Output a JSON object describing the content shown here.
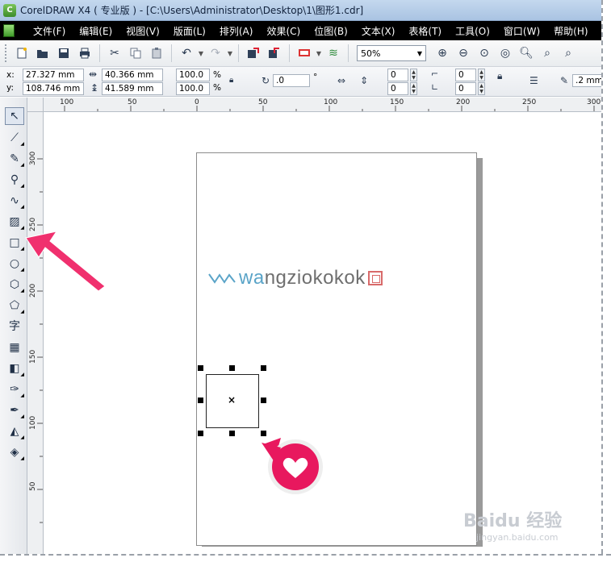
{
  "window": {
    "title": "CorelDRAW X4 ( 专业版 ) - [C:\\Users\\Administrator\\Desktop\\1\\图形1.cdr]",
    "app_icon_label": "C"
  },
  "menu": {
    "items": [
      "文件(F)",
      "编辑(E)",
      "视图(V)",
      "版面(L)",
      "排列(A)",
      "效果(C)",
      "位图(B)",
      "文本(X)",
      "表格(T)",
      "工具(O)",
      "窗口(W)",
      "帮助(H)"
    ]
  },
  "toolbar": {
    "zoom_value": "50%"
  },
  "property_bar": {
    "x_label": "x:",
    "x_value": "27.327 mm",
    "y_label": "y:",
    "y_value": "108.746 mm",
    "width_value": "40.366 mm",
    "height_value": "41.589 mm",
    "scale_x": "100.0",
    "scale_y": "100.0",
    "percent_symbol": "%",
    "rotation_value": ".0",
    "degree_symbol": "°",
    "corner_tl": "0",
    "corner_bl": "0",
    "corner_tr": "0",
    "corner_br": "0",
    "outline_width": ".2 mm"
  },
  "toolbox": {
    "text_tool_label": "字"
  },
  "rulers": {
    "horizontal_labels": [
      "100",
      "50",
      "0",
      "50",
      "100",
      "150",
      "200",
      "250",
      "300"
    ],
    "vertical_labels": [
      "300",
      "250",
      "200",
      "150",
      "100",
      "50"
    ]
  },
  "canvas": {
    "logo_text_blue": "wa",
    "logo_text_gray": "ngzi",
    "logo_text_red": "okokok"
  },
  "watermark": {
    "text": "Baidu 经验",
    "url": "jingyan.baidu.com"
  }
}
